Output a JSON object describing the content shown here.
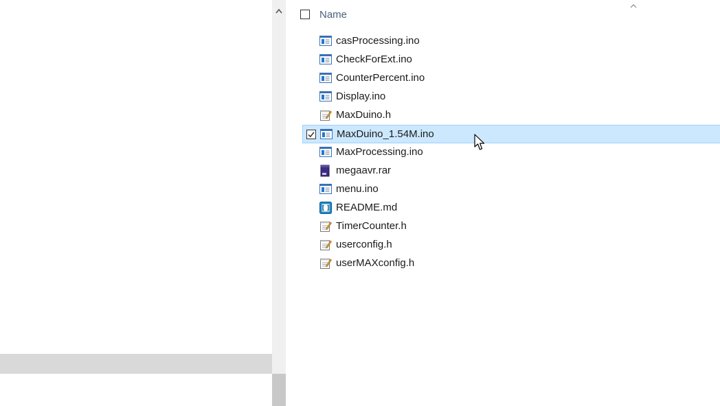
{
  "header": {
    "name_label": "Name"
  },
  "files": [
    {
      "name": "casProcessing.ino",
      "icon": "ino-file-icon"
    },
    {
      "name": "CheckForExt.ino",
      "icon": "ino-file-icon"
    },
    {
      "name": "CounterPercent.ino",
      "icon": "ino-file-icon"
    },
    {
      "name": "Display.ino",
      "icon": "ino-file-icon"
    },
    {
      "name": "MaxDuino.h",
      "icon": "header-file-icon"
    },
    {
      "name": "MaxDuino_1.54M.ino",
      "icon": "ino-file-icon",
      "selected": true
    },
    {
      "name": "MaxProcessing.ino",
      "icon": "ino-file-icon"
    },
    {
      "name": "megaavr.rar",
      "icon": "rar-archive-icon"
    },
    {
      "name": "menu.ino",
      "icon": "ino-file-icon"
    },
    {
      "name": "README.md",
      "icon": "markdown-file-icon"
    },
    {
      "name": "TimerCounter.h",
      "icon": "header-file-icon"
    },
    {
      "name": "userconfig.h",
      "icon": "header-file-icon"
    },
    {
      "name": "userMAXconfig.h",
      "icon": "header-file-icon"
    }
  ],
  "colors": {
    "selection_bg": "#cce8ff",
    "selection_border": "#99d1ff",
    "header_text": "#4c607a"
  }
}
